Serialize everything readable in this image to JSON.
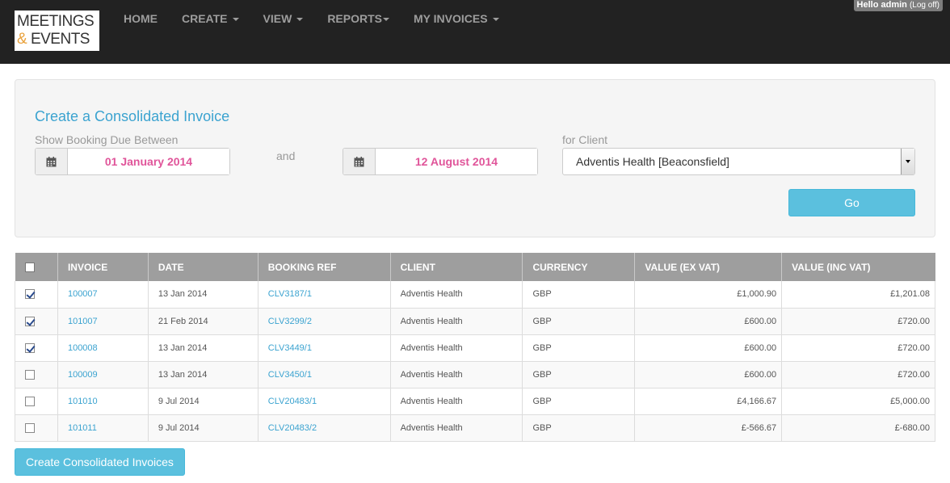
{
  "brand": {
    "line1": "MEETINGS",
    "amp": "&",
    "line2": " EVENTS"
  },
  "nav": {
    "home": "HOME",
    "create": "CREATE",
    "view": "VIEW",
    "reports": "REPORTS",
    "invoices": "MY INVOICES"
  },
  "user": {
    "greeting": "Hello admin",
    "logoff": "(Log off)"
  },
  "filter": {
    "title": "Create a Consolidated Invoice",
    "show_label": "Show Booking Due Between",
    "from_date": "01 January 2014",
    "and_label": "and",
    "to_date": "12 August 2014",
    "client_label": "for Client",
    "client_value": "Adventis Health [Beaconsfield]",
    "go_label": "Go"
  },
  "table": {
    "headers": [
      "INVOICE",
      "DATE",
      "BOOKING REF",
      "CLIENT",
      "CURRENCY",
      "VALUE (EX VAT)",
      "VALUE (INC VAT)"
    ],
    "rows": [
      {
        "checked": true,
        "invoice": "100007",
        "date": "13 Jan 2014",
        "ref": "CLV3187/1",
        "client": "Adventis Health",
        "currency": "GBP",
        "ex": "£1,000.90",
        "inc": "£1,201.08"
      },
      {
        "checked": true,
        "invoice": "101007",
        "date": "21 Feb 2014",
        "ref": "CLV3299/2",
        "client": "Adventis Health",
        "currency": "GBP",
        "ex": "£600.00",
        "inc": "£720.00"
      },
      {
        "checked": true,
        "invoice": "100008",
        "date": "13 Jan 2014",
        "ref": "CLV3449/1",
        "client": "Adventis Health",
        "currency": "GBP",
        "ex": "£600.00",
        "inc": "£720.00"
      },
      {
        "checked": false,
        "invoice": "100009",
        "date": "13 Jan 2014",
        "ref": "CLV3450/1",
        "client": "Adventis Health",
        "currency": "GBP",
        "ex": "£600.00",
        "inc": "£720.00"
      },
      {
        "checked": false,
        "invoice": "101010",
        "date": "9 Jul 2014",
        "ref": "CLV20483/1",
        "client": "Adventis Health",
        "currency": "GBP",
        "ex": "£4,166.67",
        "inc": "£5,000.00"
      },
      {
        "checked": false,
        "invoice": "101011",
        "date": "9 Jul 2014",
        "ref": "CLV20483/2",
        "client": "Adventis Health",
        "currency": "GBP",
        "ex": "£-566.67",
        "inc": "£-680.00"
      }
    ]
  },
  "actions": {
    "create_label": "Create Consolidated Invoices"
  },
  "icons": {
    "calendar": "calendar-icon",
    "checkbox": "checkbox-icon"
  },
  "colors": {
    "accent": "#5bc0de",
    "title": "#3ba3d0",
    "date_text": "#e0559a",
    "navbar": "#222222"
  }
}
